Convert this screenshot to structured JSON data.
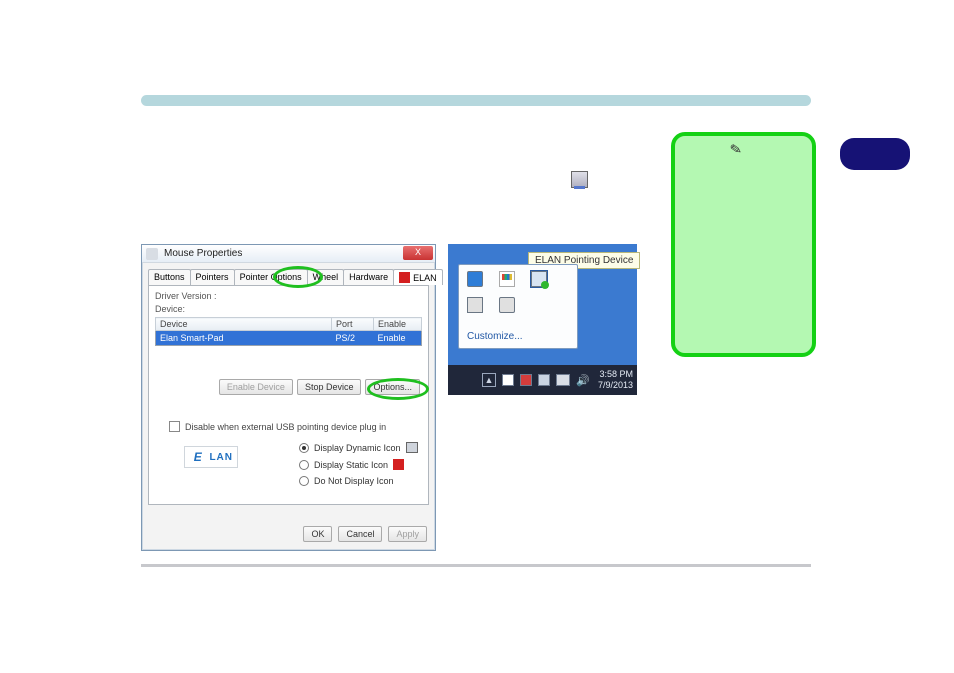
{
  "colors": {
    "accent_blue": "#3172d6",
    "highlight_green": "#1fbf1f",
    "elan_red": "#d42020",
    "note_bg": "#b4f8b2",
    "pill_navy": "#161275",
    "rule_teal": "#b5d7dd"
  },
  "dialog": {
    "title": "Mouse Properties",
    "close": "X",
    "tabs": [
      "Buttons",
      "Pointers",
      "Pointer Options",
      "Wheel",
      "Hardware",
      "ELAN"
    ],
    "active_tab": "ELAN",
    "driver_version_label": "Driver Version :",
    "device_label": "Device:",
    "columns": [
      "Device",
      "Port",
      "Enable"
    ],
    "device_row": {
      "name": "Elan Smart-Pad",
      "port": "PS/2",
      "enable": "Enable"
    },
    "buttons": {
      "enable_device": "Enable Device",
      "stop_device": "Stop Device",
      "options": "Options..."
    },
    "disable_label": "Disable when external USB pointing device plug in",
    "radios": {
      "dynamic": "Display Dynamic Icon",
      "static": "Display Static Icon",
      "none": "Do Not Display Icon",
      "selected": "dynamic"
    },
    "logo_text": "LAN",
    "footer": {
      "ok": "OK",
      "cancel": "Cancel",
      "apply": "Apply"
    }
  },
  "tray": {
    "tooltip": "ELAN Pointing Device",
    "customize": "Customize...",
    "icons": [
      "shield-icon",
      "flag-icon",
      "monitor-icon",
      "printer-icon",
      "speaker-icon"
    ],
    "highlighted_icon": "monitor-icon",
    "clock": {
      "time": "3:58 PM",
      "date": "7/9/2013"
    }
  }
}
